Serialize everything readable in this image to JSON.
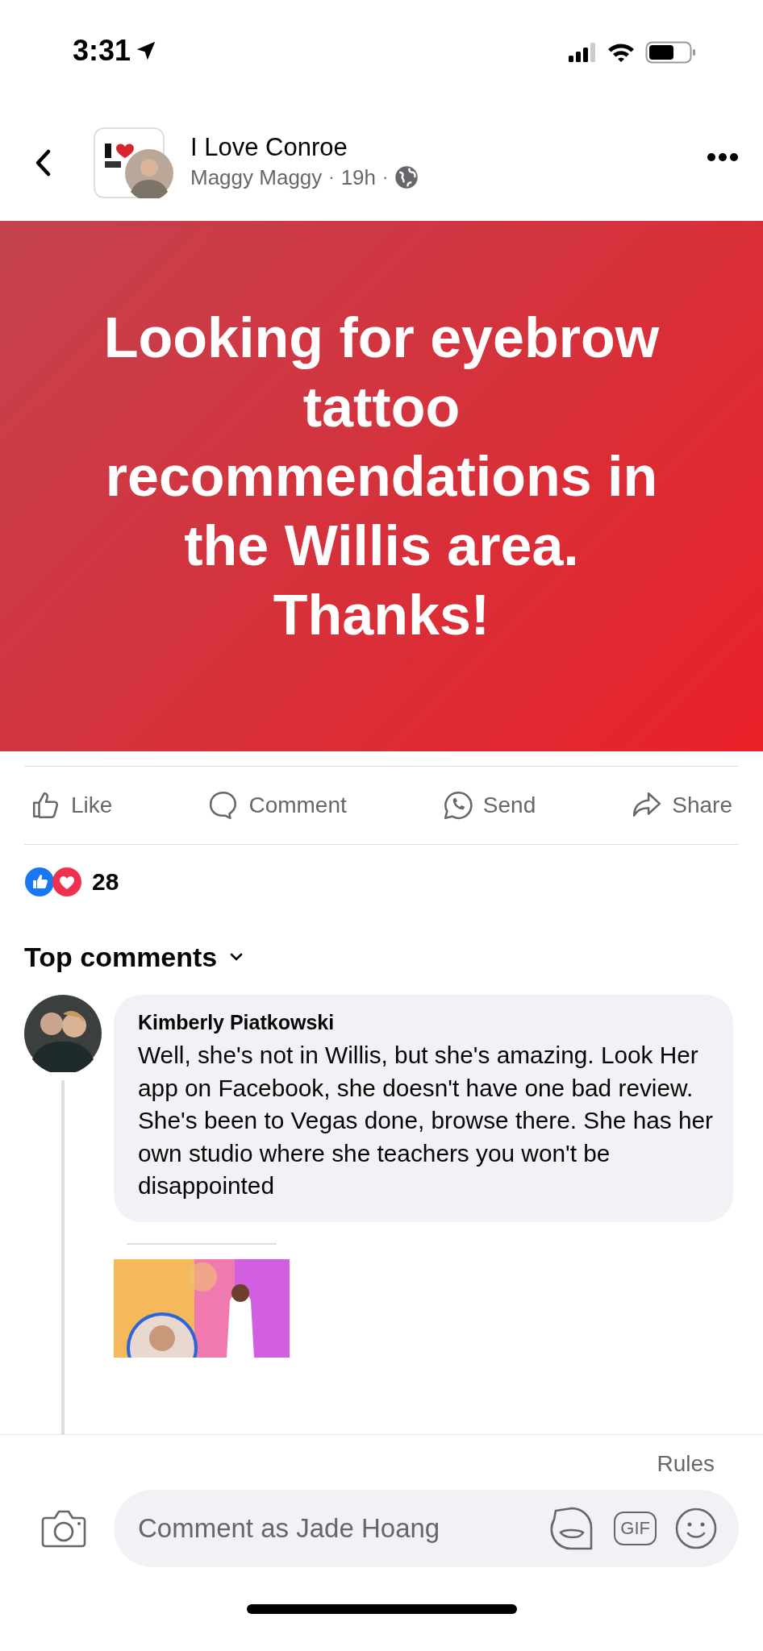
{
  "status_bar": {
    "time": "3:31"
  },
  "header": {
    "title": "I Love Conroe",
    "author": "Maggy Maggy",
    "separator_1": "·",
    "age": "19h",
    "separator_2": "·"
  },
  "post": {
    "text": "Looking for eyebrow tattoo recommendations in the Willis area. Thanks!"
  },
  "actions": [
    {
      "kind": "like",
      "label": "Like"
    },
    {
      "kind": "comment",
      "label": "Comment"
    },
    {
      "kind": "send",
      "label": "Send"
    },
    {
      "kind": "share",
      "label": "Share"
    }
  ],
  "reactions": {
    "count": "28"
  },
  "comments_header": {
    "label": "Top comments"
  },
  "comments": [
    {
      "author": "Kimberly Piatkowski",
      "text": "Well, she's not in Willis, but she's amazing. Look Her app on Facebook, she doesn't have one bad review. She's been to Vegas done, browse there. She has her own studio where she teachers you won't be disappointed"
    }
  ],
  "composer": {
    "rules_link": "Rules",
    "placeholder": "Comment as Jade Hoang",
    "gif_label": "GIF"
  }
}
